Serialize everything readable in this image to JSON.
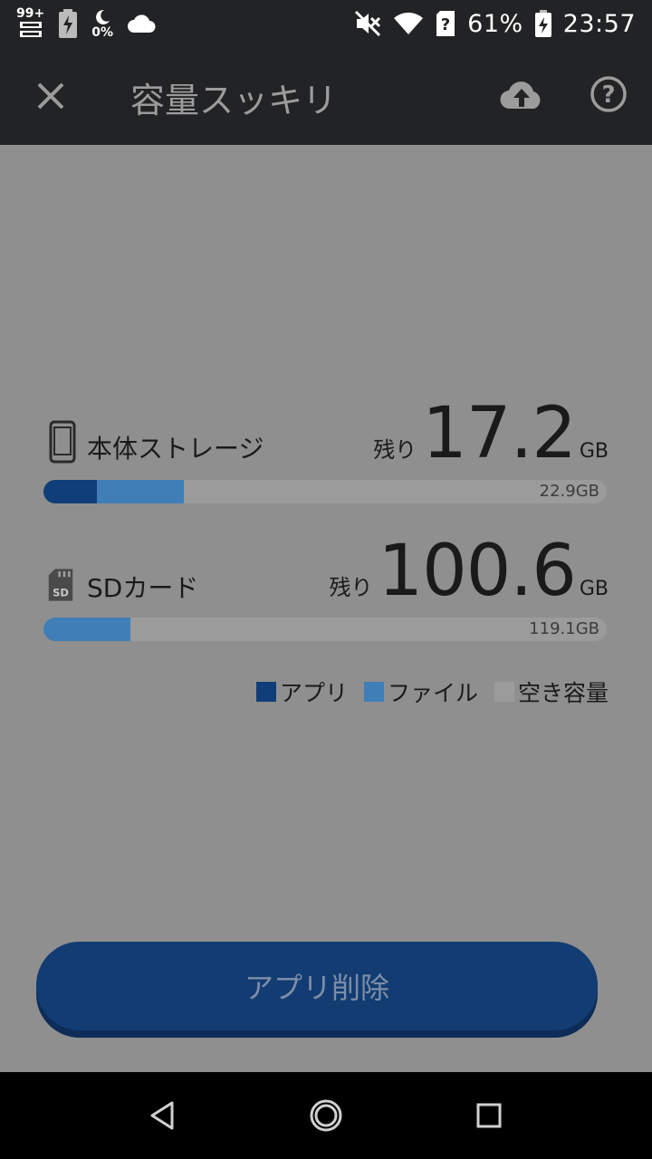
{
  "status_bar": {
    "notification_count": "99+",
    "battery_saver_percent": "0%",
    "battery_percent": "61%",
    "time": "23:57"
  },
  "toolbar": {
    "title": "容量スッキリ"
  },
  "storages": [
    {
      "label": "本体ストレージ",
      "remaining_prefix": "残り",
      "remaining_value": "17.2",
      "remaining_unit": "GB",
      "total": "22.9GB",
      "apps_fraction": 0.095,
      "files_fraction": 0.155
    },
    {
      "label": "SDカード",
      "remaining_prefix": "残り",
      "remaining_value": "100.6",
      "remaining_unit": "GB",
      "total": "119.1GB",
      "apps_fraction": 0.0,
      "files_fraction": 0.155
    }
  ],
  "legend": {
    "apps": "アプリ",
    "files": "ファイル",
    "free": "空き容量"
  },
  "colors": {
    "apps": "#0f3e78",
    "files": "#3f7eb6",
    "free": "#9b9b9b",
    "button": "#123c72"
  },
  "action_button": {
    "label": "アプリ削除"
  }
}
